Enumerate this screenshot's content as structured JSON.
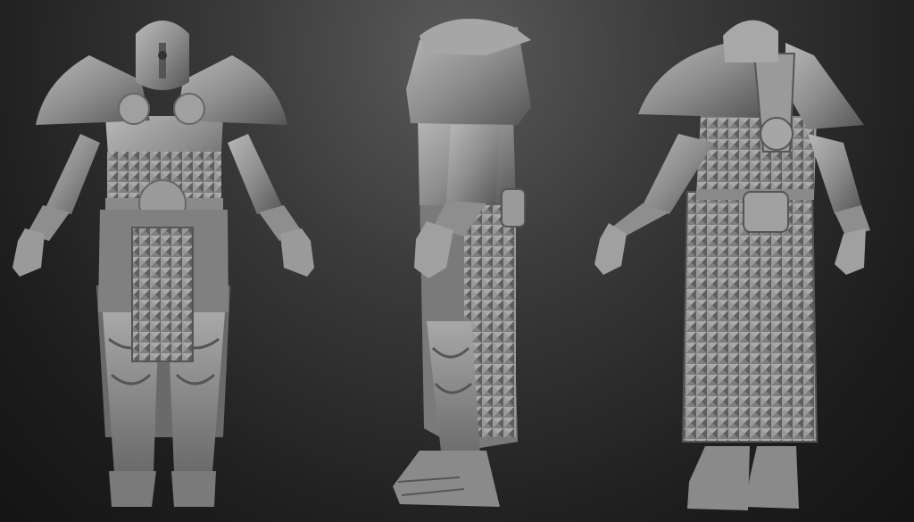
{
  "scene": {
    "description_visible_text": "",
    "colors": {
      "background_top": "#5a5a5a",
      "background_bottom": "#141414",
      "clay": "#8c8c8c",
      "clay_light": "#b4b4b4",
      "clay_shadow": "#4e4e4e"
    },
    "views": [
      {
        "name": "front-view"
      },
      {
        "name": "side-view"
      },
      {
        "name": "back-view"
      }
    ]
  }
}
